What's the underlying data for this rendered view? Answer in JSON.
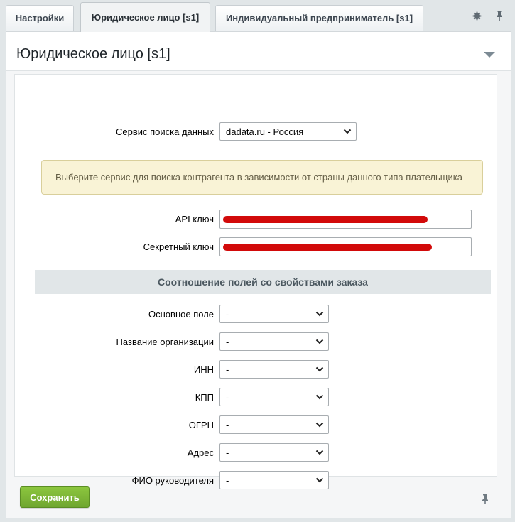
{
  "tabs": [
    {
      "label": "Настройки"
    },
    {
      "label": "Юридическое лицо [s1]"
    },
    {
      "label": "Индивидуальный предприниматель [s1]"
    }
  ],
  "toolbar_icons": [
    "gear-icon",
    "pin-icon"
  ],
  "panel": {
    "title": "Юридическое лицо [s1]"
  },
  "form": {
    "search_service": {
      "label": "Сервис поиска данных",
      "value": "dadata.ru - Россия"
    },
    "notice": "Выберите сервис для поиска контрагента в зависимости от страны данного типа плательщика",
    "api_key": {
      "label": "API ключ"
    },
    "secret_key": {
      "label": "Секретный ключ"
    },
    "section_title": "Соотношение полей со свойствами заказа",
    "mapping": [
      {
        "label": "Основное поле",
        "value": "-"
      },
      {
        "label": "Название организации",
        "value": "-"
      },
      {
        "label": "ИНН",
        "value": "-"
      },
      {
        "label": "КПП",
        "value": "-"
      },
      {
        "label": "ОГРН",
        "value": "-"
      },
      {
        "label": "Адрес",
        "value": "-"
      },
      {
        "label": "ФИО руководителя",
        "value": "-"
      }
    ]
  },
  "footer": {
    "save_label": "Сохранить"
  },
  "colors": {
    "accent_green": "#7ab838",
    "redaction": "#d20a0a",
    "notice_bg": "#f9f3d6"
  }
}
